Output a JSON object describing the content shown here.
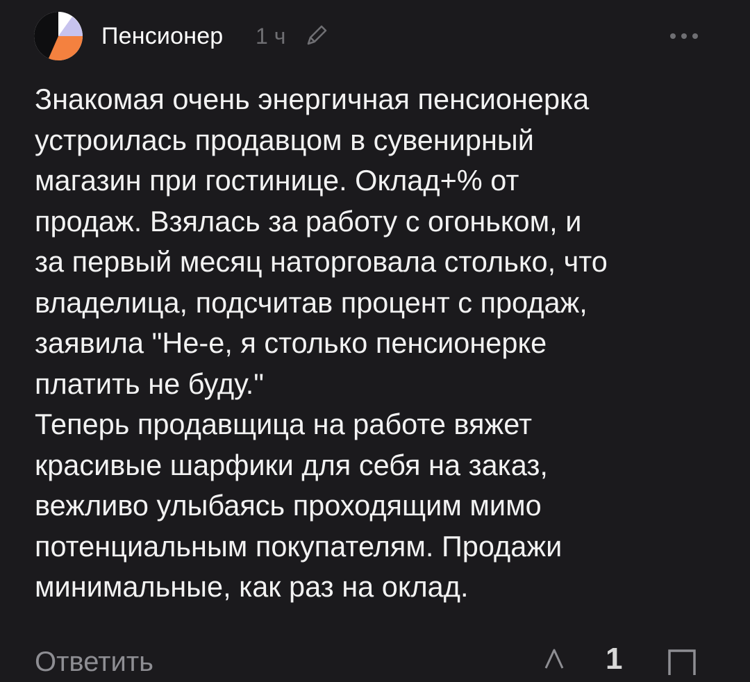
{
  "comment": {
    "author": "Пенсионер",
    "time": "1 ч",
    "text": "Знакомая очень энергичная пенсионерка\nустроилась продавцом в сувенирный\nмагазин при гостинице. Оклад+% от\nпродаж. Взялась за работу с огоньком, и\nза первый месяц наторговала столько, что\nвладелица, подсчитав процент с продаж,\nзаявила \"Не-е, я столько пенсионерке\nплатить не буду.\"\nТеперь продавщица на работе вяжет\nкрасивые шарфики для себя на заказ,\nвежливо улыбаясь проходящим мимо\nпотенциальным покупателям. Продажи\nминимальные, как раз на оклад.",
    "reply_label": "Ответить",
    "rating": "1"
  },
  "icons": {
    "avatar": "avatar-logo-icon",
    "edit": "pencil-icon",
    "more": "more-dots-icon",
    "vote": "vote-arrow-icon",
    "bookmark": "bookmark-icon"
  },
  "colors": {
    "background": "#1b1a1d",
    "text": "#f2f2f2",
    "muted": "#6f6f73",
    "avatar_accent": "#f4813f",
    "avatar_secondary": "#c7c3ee"
  }
}
